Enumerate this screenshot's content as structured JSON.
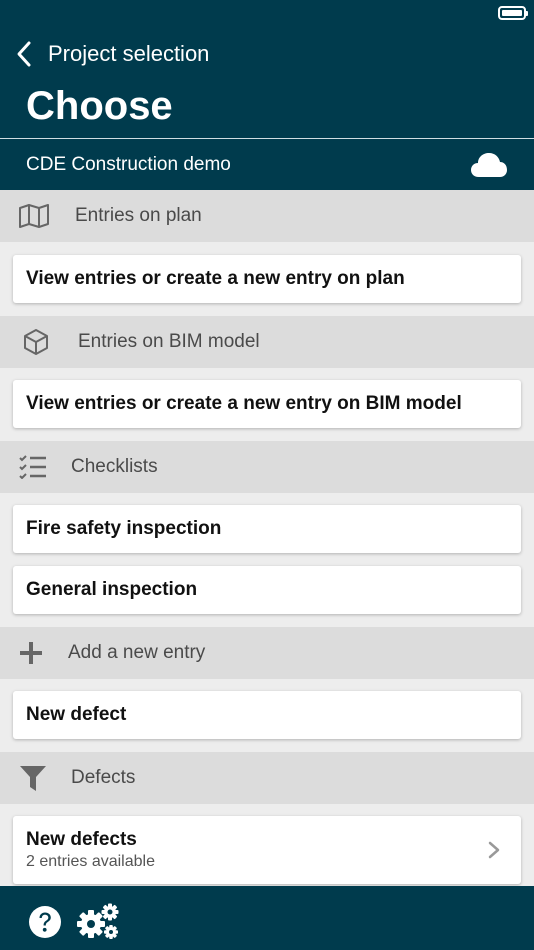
{
  "header": {
    "back_label": "Project selection",
    "title": "Choose",
    "project_name": "CDE Construction demo",
    "cloud_icon": "cloud-icon",
    "colors": {
      "bar": "#003b4d",
      "background": "#ededed",
      "section": "#dcdcdc"
    }
  },
  "sections": {
    "plan": {
      "label": "Entries on plan",
      "icon": "map-icon"
    },
    "bim": {
      "label": "Entries on BIM model",
      "icon": "cube-icon"
    },
    "checklists": {
      "label": "Checklists",
      "icon": "checklist-icon"
    },
    "add_entry": {
      "label": "Add a new entry",
      "icon": "plus-icon"
    },
    "defects": {
      "label": "Defects",
      "icon": "filter-icon"
    }
  },
  "cards": {
    "plan_view": "View entries or create a new entry on plan",
    "bim_view": "View entries or create a new entry on BIM model",
    "fire_safety": "Fire safety inspection",
    "general": "General inspection",
    "new_defect": "New defect",
    "new_defects": {
      "title": "New defects",
      "subtitle": "2 entries available"
    }
  },
  "footer": {
    "help_icon": "help-icon",
    "settings_icon": "gears-icon"
  }
}
